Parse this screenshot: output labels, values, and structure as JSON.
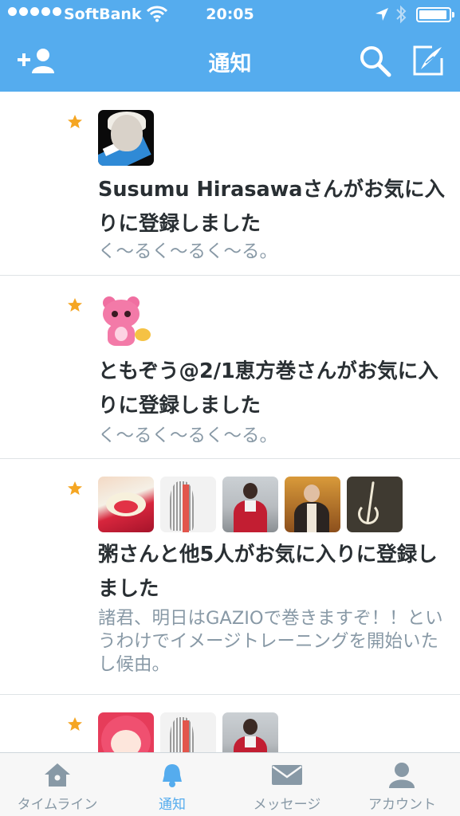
{
  "status_bar": {
    "carrier": "SoftBank",
    "time": "20:05"
  },
  "nav": {
    "title": "通知"
  },
  "notifications": [
    {
      "user": "Susumu Hirasawa",
      "action": "さんがお気に入りに登録しました",
      "tweet": "く〜るく〜るく〜る。"
    },
    {
      "user": "ともぞう@2/1恵方巻",
      "action": "さんがお気に入りに登録しました",
      "tweet": "く〜るく〜るく〜る。"
    },
    {
      "user": "粥",
      "action": "さんと他5人がお気に入りに登録しました",
      "tweet": "諸君、明日はGAZIOで巻きますぞ！！というわけでイメージトレーニングを開始いたし候由。"
    },
    {
      "user": "",
      "action": "",
      "tweet": ""
    }
  ],
  "tabs": [
    {
      "label": "タイムライン",
      "icon": "home-icon",
      "active": false
    },
    {
      "label": "通知",
      "icon": "bell-icon",
      "active": true
    },
    {
      "label": "メッセージ",
      "icon": "envelope-icon",
      "active": false
    },
    {
      "label": "アカウント",
      "icon": "person-icon",
      "active": false
    }
  ],
  "colors": {
    "brand": "#55acee",
    "star": "#f5a623",
    "text": "#292f33",
    "subtext": "#8899a6"
  }
}
